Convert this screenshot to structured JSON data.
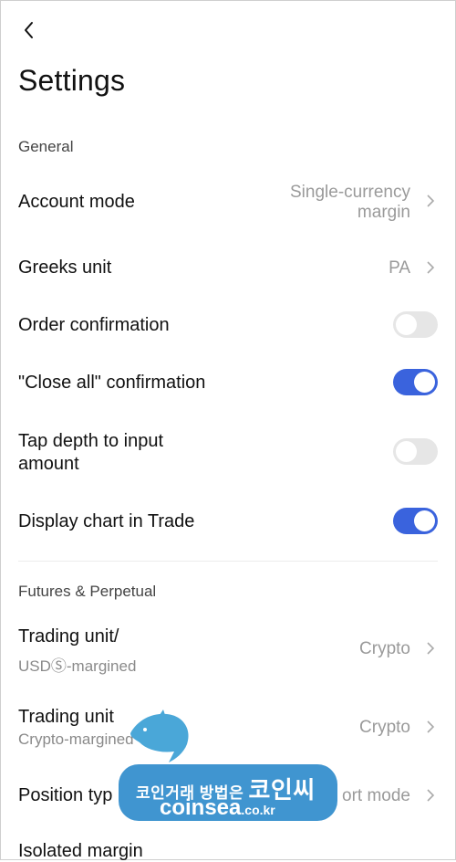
{
  "header": {
    "back_icon": "chevron-left-icon",
    "title": "Settings"
  },
  "sections": {
    "general": "General",
    "futures": "Futures & Perpetual"
  },
  "settings": {
    "account_mode": {
      "label": "Account mode",
      "value_line1": "Single-currency",
      "value_line2": "margin"
    },
    "greeks_unit": {
      "label": "Greeks unit",
      "value": "PA"
    },
    "order_confirmation": {
      "label": "Order confirmation",
      "enabled": false
    },
    "close_all_confirmation": {
      "label": "\"Close all\" confirmation",
      "enabled": true
    },
    "tap_depth": {
      "label_line1": "Tap depth to input",
      "label_line2": "amount",
      "enabled": false
    },
    "display_chart": {
      "label": "Display chart in Trade",
      "enabled": true
    },
    "trading_unit_usd": {
      "label": "Trading unit/",
      "sub": "USDⓈ-margined",
      "value": "Crypto"
    },
    "trading_unit_crypto": {
      "label": "Trading unit",
      "sub": "Crypto-margined",
      "value": "Crypto"
    },
    "position_type": {
      "label": "Position typ",
      "value": "ort mode"
    },
    "isolated_margin": {
      "label": "Isolated margin"
    }
  },
  "watermark": {
    "line1": "코인거래 방법은",
    "line1_big": "코인씨",
    "line2": "coinsea",
    "line2_small": ".co.kr"
  },
  "colors": {
    "toggle_on": "#3a63dd",
    "toggle_off": "#e6e6e6"
  }
}
